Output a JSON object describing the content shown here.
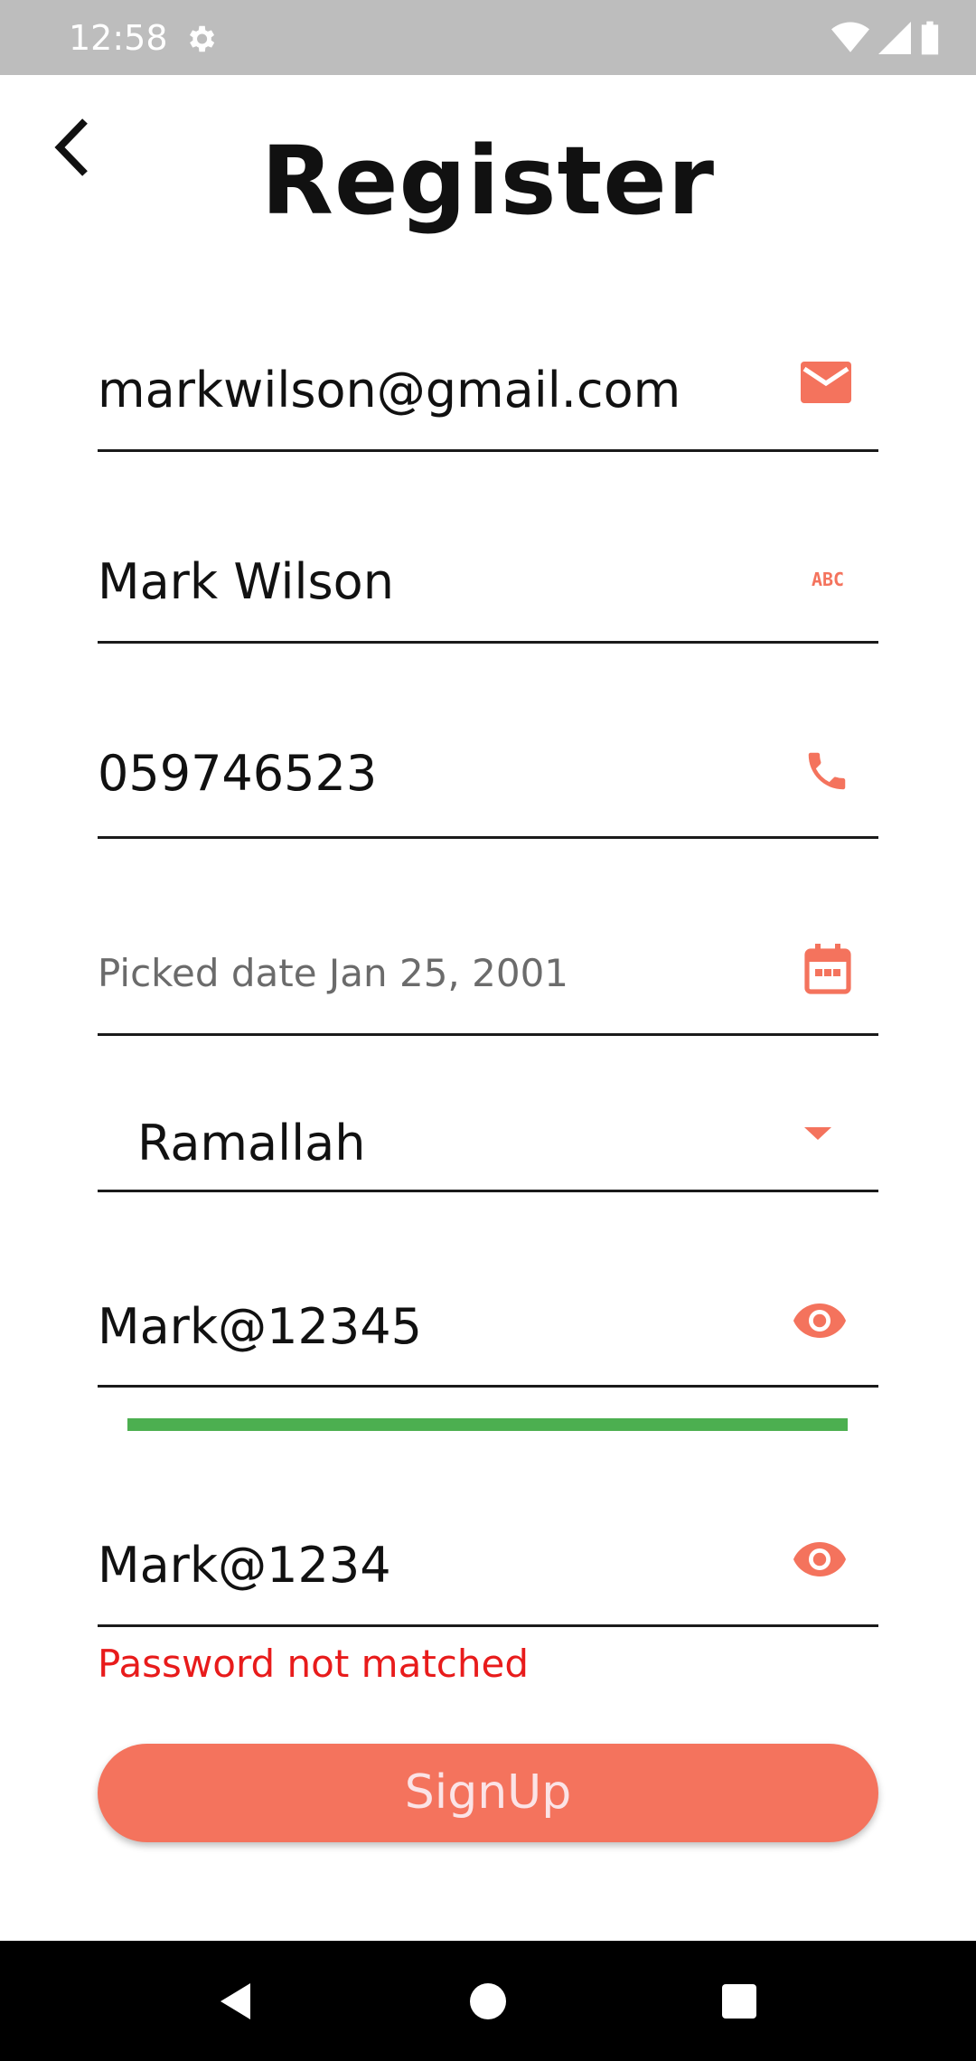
{
  "status_bar": {
    "time": "12:58",
    "icons": [
      "gear-icon",
      "wifi-icon",
      "signal-icon",
      "battery-icon"
    ]
  },
  "header": {
    "title": "Register",
    "back_icon": "chevron-left-icon"
  },
  "form": {
    "email": {
      "value": "markwilson@gmail.com",
      "icon": "mail-icon"
    },
    "name": {
      "value": "Mark Wilson",
      "icon": "abc-icon",
      "icon_text": "ABC"
    },
    "phone": {
      "value": "059746523",
      "icon": "phone-icon"
    },
    "date": {
      "value": "Picked date Jan 25, 2001",
      "icon": "calendar-icon"
    },
    "city": {
      "value": "Ramallah",
      "icon": "dropdown-arrow-icon"
    },
    "password": {
      "value": "Mark@12345",
      "icon": "eye-icon",
      "strength": 1.0
    },
    "confirm_password": {
      "value": "Mark@1234",
      "icon": "eye-icon",
      "error": "Password not matched"
    }
  },
  "signup_button": {
    "label": "SignUp"
  },
  "colors": {
    "accent": "#f4735d",
    "error": "#e81b1b",
    "strength": "#4caf50",
    "status_bar": "#bdbdbd"
  },
  "nav_bar": {
    "icons": [
      "back-triangle-icon",
      "home-circle-icon",
      "recents-square-icon"
    ]
  }
}
